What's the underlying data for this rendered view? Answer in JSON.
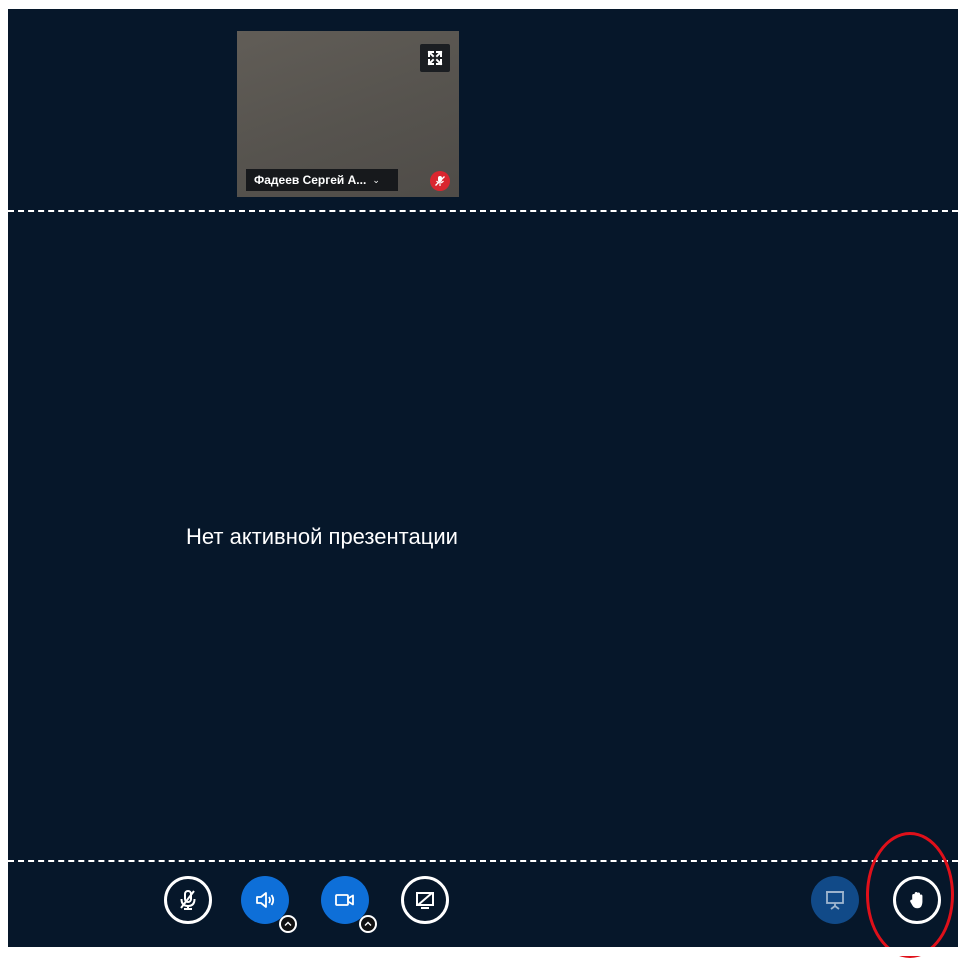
{
  "webcam": {
    "user_name": "Фадеев Сергей А...",
    "name_dropdown_icon": "chevron-down-icon",
    "fullscreen_icon": "fullscreen-icon",
    "status_icon": "microphone-muted-icon"
  },
  "presentation": {
    "empty_message": "Нет активной презентации"
  },
  "controls": {
    "mic": {
      "icon": "microphone-off-icon"
    },
    "audio": {
      "icon": "speaker-icon",
      "options_icon": "chevron-up-icon"
    },
    "video": {
      "icon": "camera-icon",
      "options_icon": "chevron-up-icon"
    },
    "screenshare": {
      "icon": "screenshare-off-icon"
    },
    "presentation_toggle": {
      "icon": "presentation-icon"
    },
    "raise_hand": {
      "icon": "hand-icon"
    }
  },
  "colors": {
    "background": "#06172a",
    "accent_blue": "#0e6fd8",
    "muted_red": "#d9262f",
    "highlight_red": "#e0101a"
  }
}
